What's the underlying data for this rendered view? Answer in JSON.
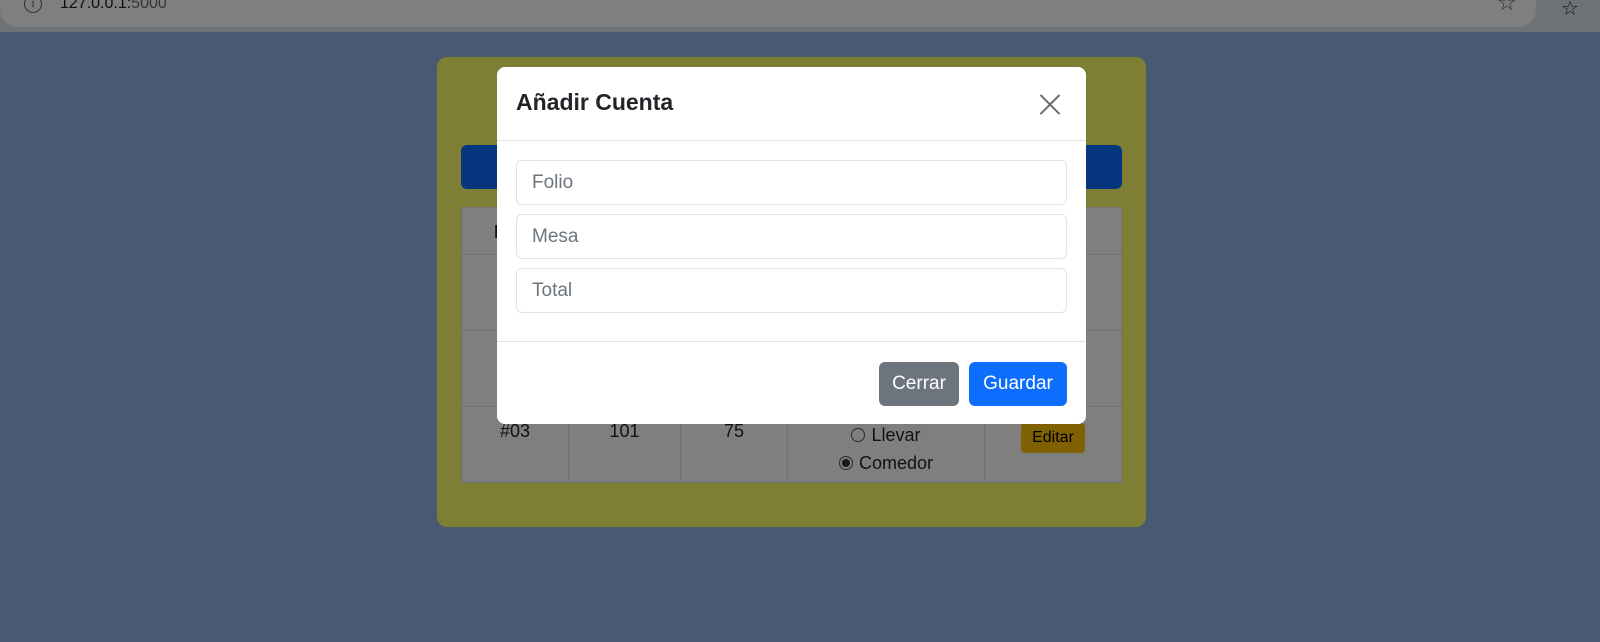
{
  "browser": {
    "url_host": "127.0.0.1:",
    "url_port": "5000"
  },
  "table": {
    "header_first": "F",
    "last_row": {
      "folio": "#03",
      "mesa": "101",
      "total": "75",
      "option_llevar": "Llevar",
      "option_comedor": "Comedor",
      "selected_option": "Comedor",
      "edit_label": "Editar"
    }
  },
  "modal": {
    "title": "Añadir Cuenta",
    "fields": {
      "folio_placeholder": "Folio",
      "mesa_placeholder": "Mesa",
      "total_placeholder": "Total"
    },
    "buttons": {
      "close_label": "Cerrar",
      "save_label": "Guardar"
    }
  },
  "colors": {
    "page_background": "#8fb4e3",
    "card_background": "#fdfd6a",
    "primary": "#0d6efd",
    "secondary": "#6c757d",
    "warning": "#ffc107"
  }
}
